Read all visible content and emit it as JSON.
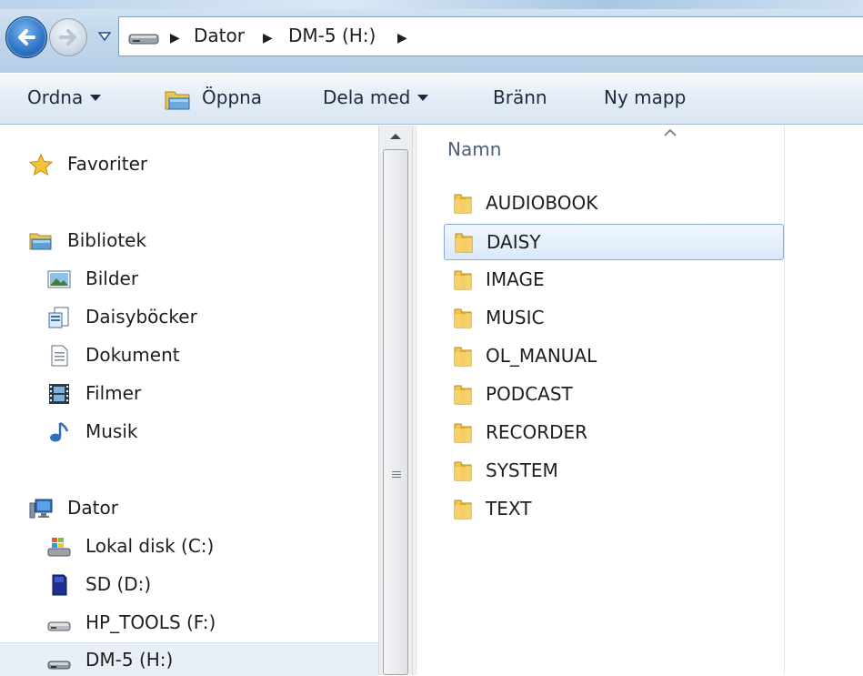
{
  "address": {
    "crumbs": [
      "Dator",
      "DM-5 (H:)"
    ]
  },
  "toolbar": {
    "organize": "Ordna",
    "open": "Öppna",
    "share": "Dela med",
    "burn": "Bränn",
    "new_folder": "Ny mapp"
  },
  "nav": {
    "favorites": "Favoriter",
    "libraries": "Bibliotek",
    "pictures": "Bilder",
    "daisy_books": "Daisyböcker",
    "documents": "Dokument",
    "videos": "Filmer",
    "music": "Musik",
    "computer": "Dator",
    "drive_c": "Lokal disk (C:)",
    "drive_d": "SD (D:)",
    "drive_f": "HP_TOOLS (F:)",
    "drive_h": "DM-5 (H:)"
  },
  "filelist": {
    "column_name": "Namn",
    "sort_direction": "ascending",
    "items": [
      "AUDIOBOOK",
      "DAISY",
      "IMAGE",
      "MUSIC",
      "OL_MANUAL",
      "PODCAST",
      "RECORDER",
      "SYSTEM",
      "TEXT"
    ],
    "selected": "DAISY"
  },
  "icons": {
    "back": "back-arrow-icon",
    "forward": "forward-arrow-icon",
    "folder": "folder-icon",
    "drive": "drive-icon",
    "star": "star-icon"
  },
  "colors": {
    "selection_border": "#84acdd",
    "selection_fill": "#d9e9fb",
    "folder_yellow": "#f2c650"
  }
}
